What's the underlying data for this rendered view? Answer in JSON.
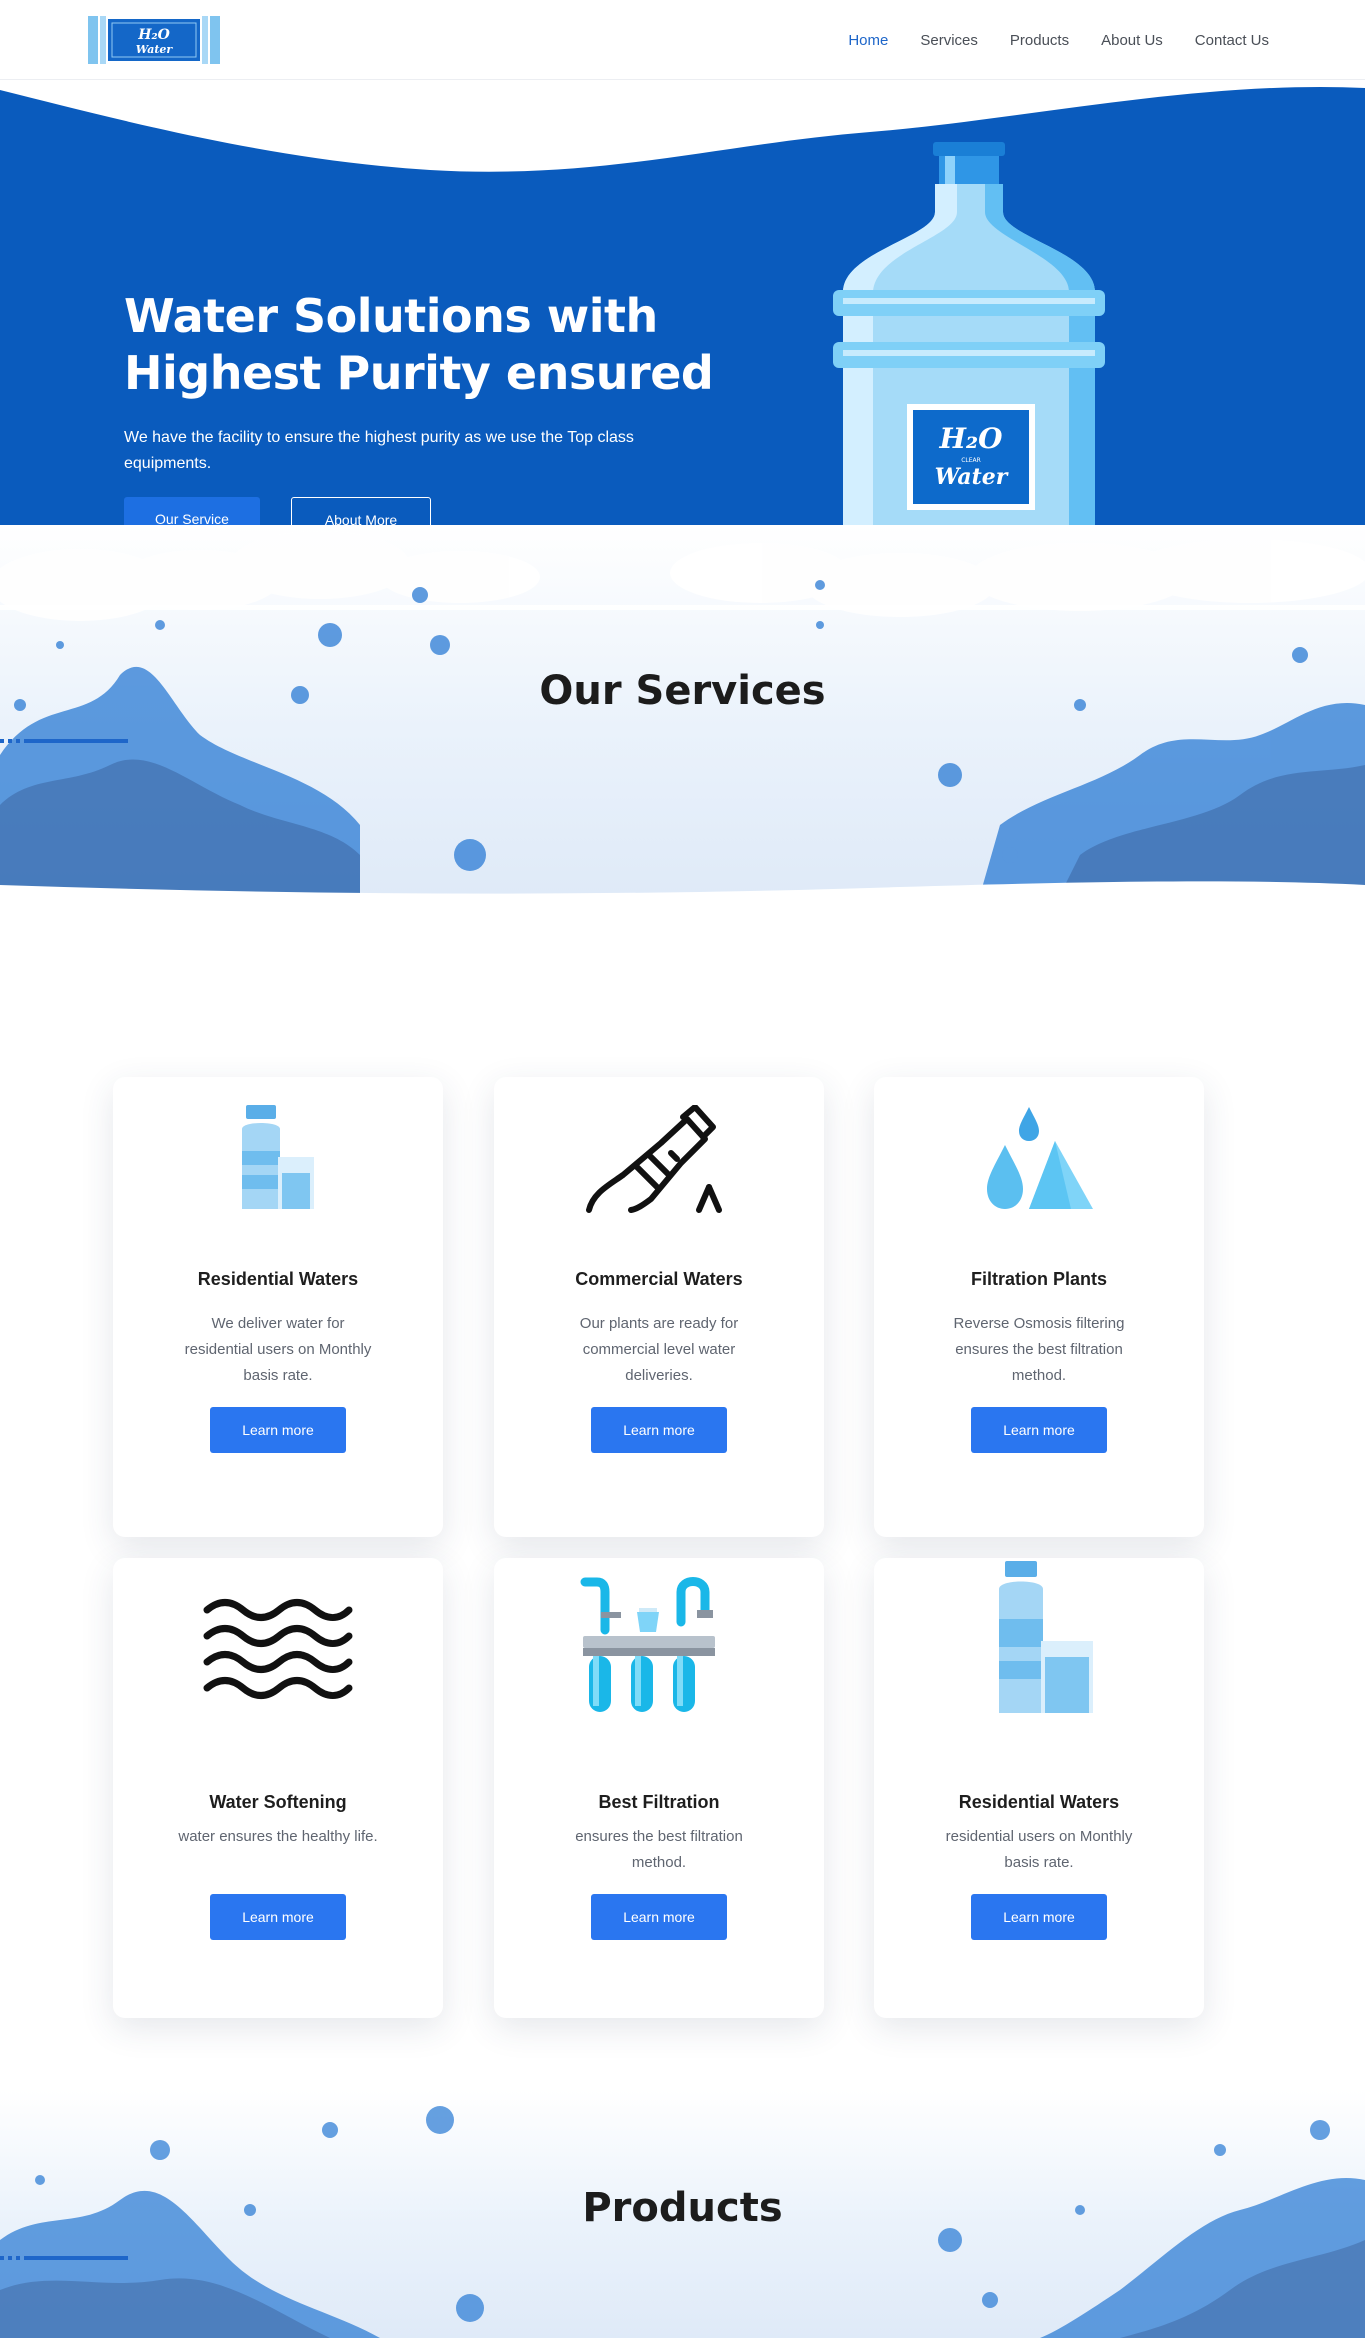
{
  "brand": {
    "logo_line1": "H₂O",
    "logo_line2": "Water"
  },
  "nav": {
    "items": [
      "Home",
      "Services",
      "Products",
      "About Us",
      "Contact Us"
    ],
    "active": "Home"
  },
  "hero": {
    "title_line1": "Water Solutions with",
    "title_line2": "Highest Purity ensured",
    "subtitle": "We have the facility to ensure the highest purity as we use the Top class equipments.",
    "primary_button": "Our Service",
    "secondary_button": "About More",
    "bottle_label_top": "H₂O",
    "bottle_label_mid": "CLEAR",
    "bottle_label_bottom": "Water"
  },
  "services": {
    "title_light": "Our",
    "title_bold": "Services",
    "cards": [
      {
        "icon": "bottle-glass-icon",
        "title": "Residential Waters",
        "desc": "We deliver water for residential users on Monthly basis rate.",
        "button": "Learn more"
      },
      {
        "icon": "pouring-bottle-icon",
        "title": "Commercial Waters",
        "desc": "Our plants are ready for commercial level water deliveries.",
        "button": "Learn more"
      },
      {
        "icon": "water-drops-icon",
        "title": "Filtration Plants",
        "desc": "Reverse Osmosis filtering ensures the best filtration method.",
        "button": "Learn more"
      },
      {
        "icon": "waves-icon",
        "title": "Water Softening",
        "desc": "water ensures the healthy life.",
        "button": "Learn more"
      },
      {
        "icon": "filter-system-icon",
        "title": "Best Filtration",
        "desc": "ensures the best filtration method.",
        "button": "Learn more"
      },
      {
        "icon": "bottle-glass-icon",
        "title": "Residential Waters",
        "desc": "residential users on Monthly basis rate.",
        "button": "Learn more"
      }
    ]
  },
  "products": {
    "title": "Products"
  },
  "colors": {
    "primary": "#0a5bbd",
    "button": "#2a76f0",
    "accent_line": "#1e66c9"
  }
}
